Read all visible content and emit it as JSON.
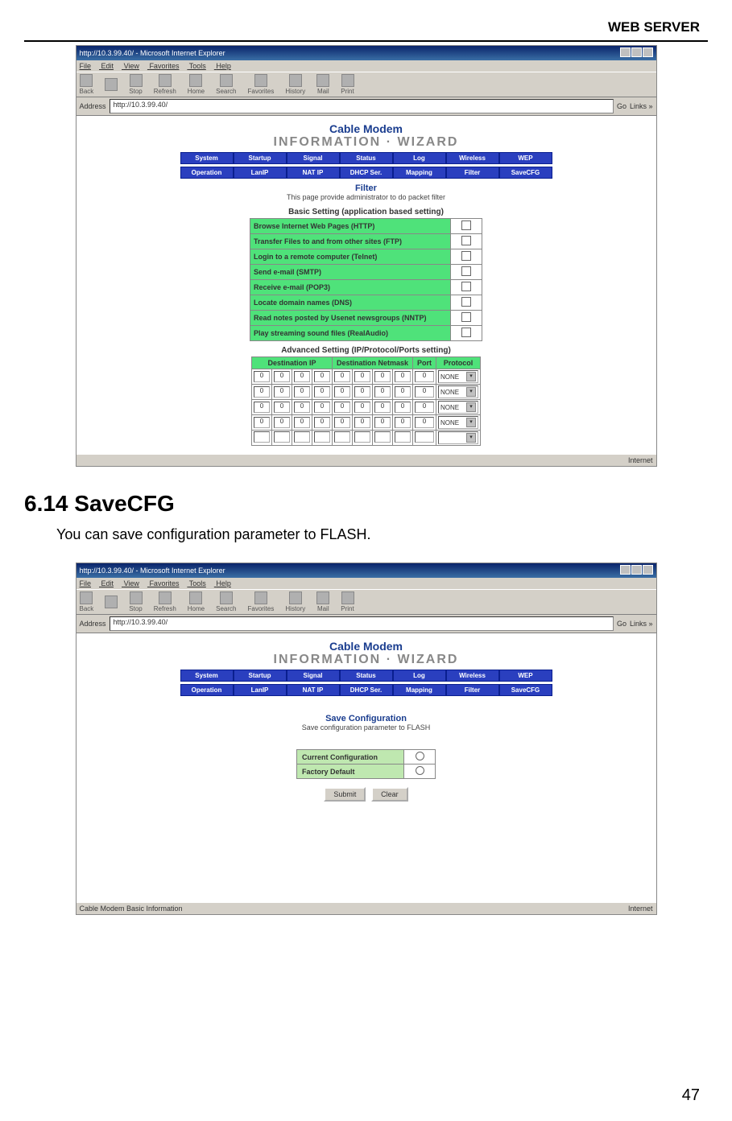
{
  "running_head": "WEB SERVER",
  "page_number": "47",
  "section_heading": "6.14 SaveCFG",
  "section_body": "You can save configuration parameter to FLASH.",
  "browser": {
    "title": "http://10.3.99.40/ - Microsoft Internet Explorer",
    "menus": [
      "File",
      "Edit",
      "View",
      "Favorites",
      "Tools",
      "Help"
    ],
    "toolbar": [
      "Back",
      "",
      "Stop",
      "Refresh",
      "Home",
      "Search",
      "Favorites",
      "History",
      "Mail",
      "Print"
    ],
    "address_label": "Address",
    "address_value": "http://10.3.99.40/",
    "go_label": "Go",
    "links_label": "Links »",
    "status_internet": "Internet"
  },
  "brand": {
    "line1": "Cable Modem",
    "line2a": "INFORMATION",
    "dot": "·",
    "line2b": "WIZARD"
  },
  "nav_row1": [
    "System",
    "Startup",
    "Signal",
    "Status",
    "Log",
    "Wireless",
    "WEP"
  ],
  "nav_row2": [
    "Operation",
    "LanIP",
    "NAT IP",
    "DHCP Ser.",
    "Mapping",
    "Filter",
    "SaveCFG"
  ],
  "filter_page": {
    "title": "Filter",
    "subtitle": "This page provide administrator to do packet filter",
    "basic_caption": "Basic Setting (application based setting)",
    "basic_rows": [
      "Browse Internet Web Pages (HTTP)",
      "Transfer Files to and from other sites (FTP)",
      "Login to a remote computer (Telnet)",
      "Send e-mail (SMTP)",
      "Receive e-mail (POP3)",
      "Locate domain names (DNS)",
      "Read notes posted by Usenet newsgroups (NNTP)",
      "Play streaming sound files (RealAudio)"
    ],
    "adv_caption": "Advanced Setting (IP/Protocol/Ports setting)",
    "adv_headers": [
      "Destination IP",
      "Destination Netmask",
      "Port",
      "Protocol"
    ],
    "adv_default_octet": "0",
    "adv_protocol": "NONE",
    "adv_row_count": 5
  },
  "savecfg_page": {
    "title": "Save Configuration",
    "subtitle": "Save configuration parameter to FLASH",
    "rows": [
      "Current Configuration",
      "Factory Default"
    ],
    "buttons": [
      "Submit",
      "Clear"
    ],
    "status_left": "Cable Modem Basic Information"
  }
}
